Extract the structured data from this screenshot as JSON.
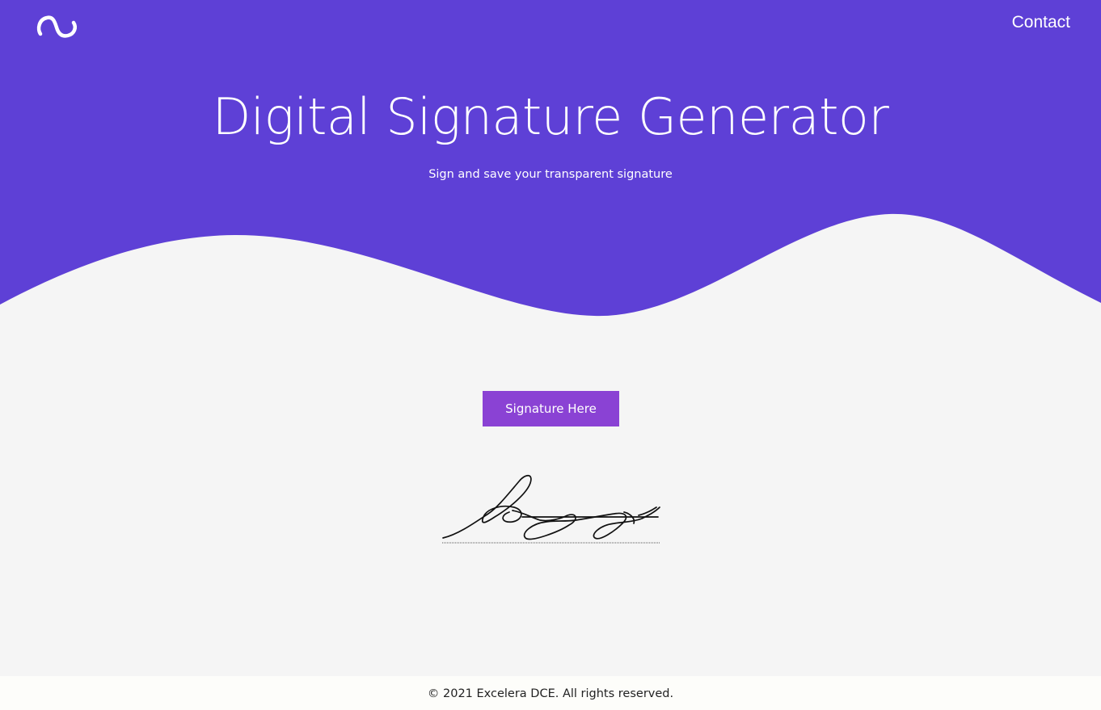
{
  "header": {
    "logo_icon": "infinity-wave-logo-icon",
    "nav_contact_label": "Contact"
  },
  "hero": {
    "title": "Digital Signature Generator",
    "subtitle": "Sign and save your transparent signature"
  },
  "main": {
    "signature_button_label": "Signature Here",
    "signature_preview_icon": "handwritten-signature"
  },
  "footer": {
    "copyright": "© 2021 Excelera DCE. All rights reserved."
  },
  "colors": {
    "hero_background": "#5e40d6",
    "page_background": "#f5f5f5",
    "button_background": "#8a42d4",
    "footer_background": "#fdfdfa"
  }
}
